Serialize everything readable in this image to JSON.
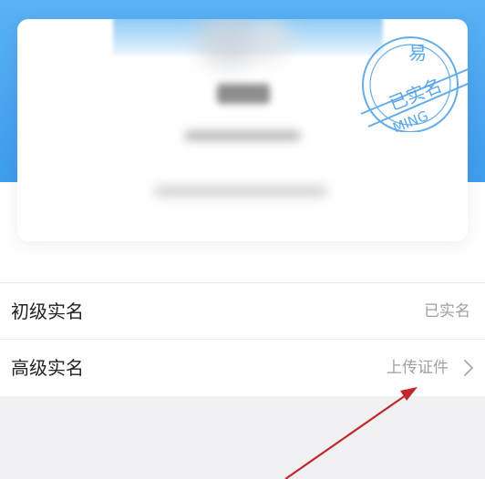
{
  "card": {
    "stamp": {
      "char_top": "易",
      "text_main": "已实名",
      "text_bottom": "MING",
      "color": "#4a9fe6"
    }
  },
  "rows": [
    {
      "label": "初级实名",
      "value": "已实名"
    },
    {
      "label": "高级实名",
      "value": "上传证件",
      "icon": "chevron-right-icon"
    }
  ],
  "colors": {
    "header_blue": "#4aa4f0",
    "background": "#f1f1f4",
    "annotation_arrow": "#c0282a"
  }
}
